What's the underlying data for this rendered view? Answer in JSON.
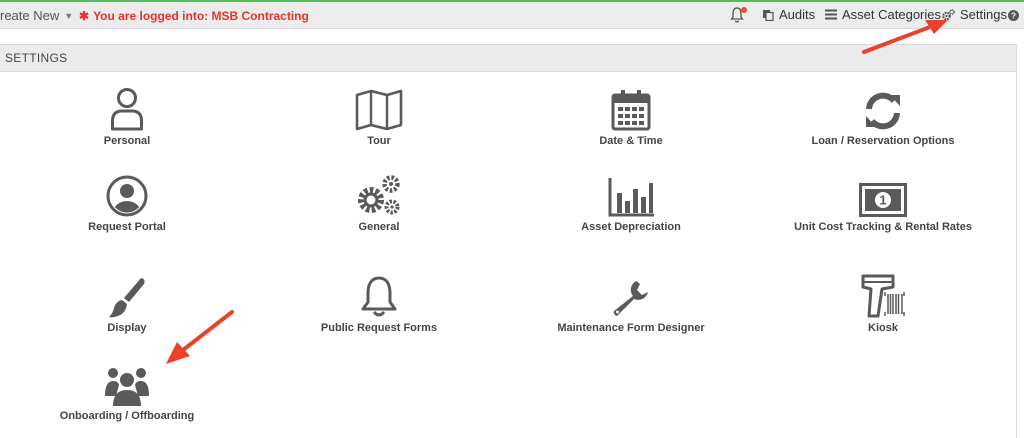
{
  "topbar": {
    "create_new": "reate New",
    "logged_in_prefix": "You are logged into: MSB Contracting",
    "nav": [
      {
        "label": "Audits"
      },
      {
        "label": "Asset Categories"
      },
      {
        "label": "Settings"
      }
    ]
  },
  "panel": {
    "title": "SETTINGS"
  },
  "tiles": [
    {
      "label": "Personal"
    },
    {
      "label": "Tour"
    },
    {
      "label": "Date & Time"
    },
    {
      "label": "Loan / Reservation Options"
    },
    {
      "label": "Request Portal"
    },
    {
      "label": "General"
    },
    {
      "label": "Asset Depreciation"
    },
    {
      "label": "Unit Cost Tracking & Rental Rates"
    },
    {
      "label": "Display"
    },
    {
      "label": "Public Request Forms"
    },
    {
      "label": "Maintenance Form Designer"
    },
    {
      "label": "Kiosk"
    },
    {
      "label": "Onboarding / Offboarding"
    }
  ],
  "colors": {
    "accent_red": "#e8332a",
    "icon_gray": "#5a5a5a",
    "arrow_red": "#e8432a",
    "top_border": "#5cb85c"
  }
}
